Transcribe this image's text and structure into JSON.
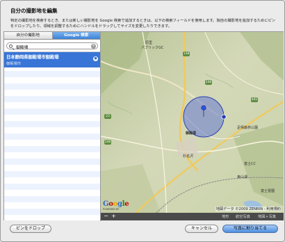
{
  "dialog": {
    "title": "自分の撮影地を編集",
    "description": "特定の撮影地を検索するとき、または新しい撮影地を Google 検索で追加するときは、以下の検索フィールドを使用します。独自の撮影地を追加するためにピンをドロップしたり、領域を調整するためにハンドルをドラッグしてサイズを変更したりできます。"
  },
  "tabs": [
    {
      "label": "自分の撮影地",
      "active": false
    },
    {
      "label": "Google 検索",
      "active": true
    }
  ],
  "search": {
    "value": "御殿場",
    "icon": "magnifier-icon",
    "clear_icon": "clear-icon"
  },
  "results": [
    {
      "title": "日本静岡県御殿場市御殿場",
      "subtitle": "御殿場市",
      "selected": true
    }
  ],
  "map": {
    "labels": {
      "a": "原里",
      "b": "パブリックGC",
      "c": "足柄森林公園",
      "d": "御殿場",
      "e": "杉名沢",
      "f": "富士CC",
      "g": "東山湖",
      "h": "富士霊園"
    },
    "shields": [
      "138",
      "246",
      "401",
      "23",
      "246"
    ],
    "copyright": "地図データ ©2009 ZENRIN - 利用規約",
    "powered_by": "POWERED BY",
    "logo": "Google",
    "zoom_out": "−",
    "zoom_in": "+",
    "map_types": [
      "地形",
      "航空写真",
      "地図＋写真"
    ]
  },
  "buttons": {
    "drop_pin": "ピンをドロップ",
    "cancel": "キャンセル",
    "assign": "写真に割り当てる"
  }
}
